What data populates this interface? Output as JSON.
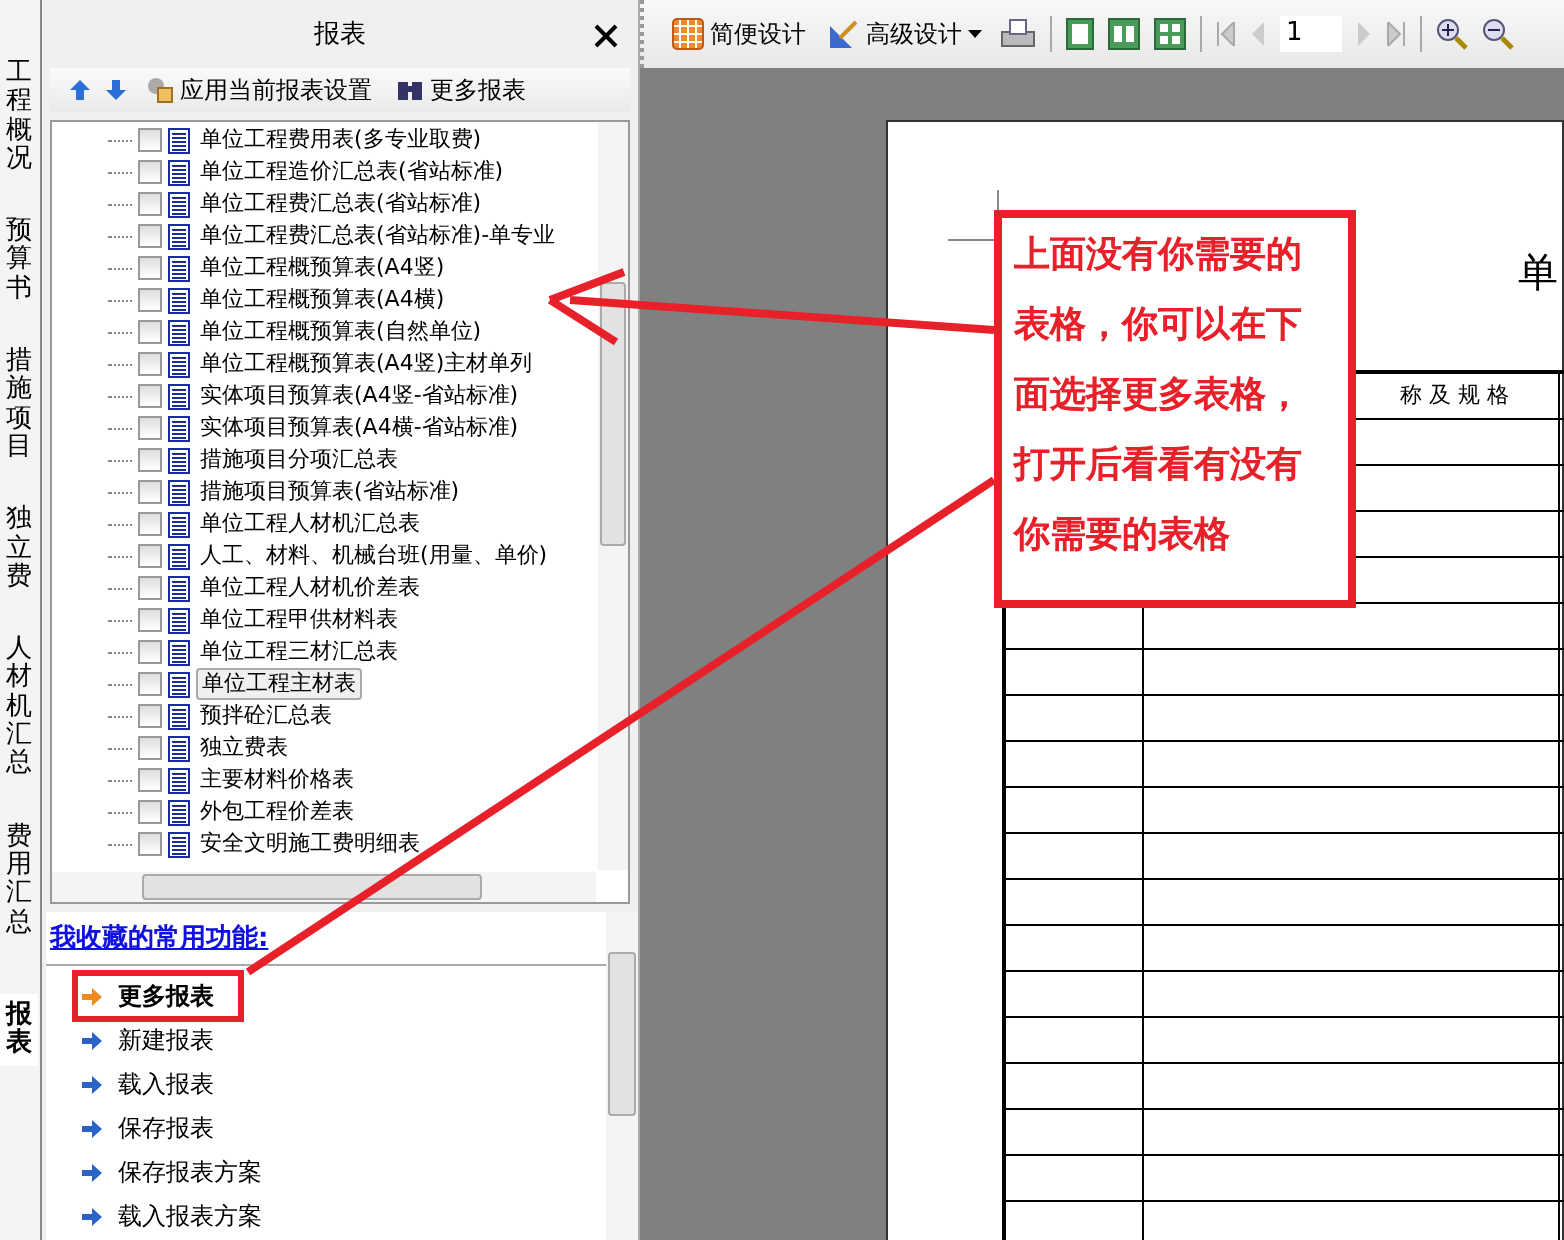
{
  "side_tabs": [
    {
      "label": "工程概况",
      "selected": false
    },
    {
      "label": "预算书",
      "selected": false
    },
    {
      "label": "措施项目",
      "selected": false
    },
    {
      "label": "独立费",
      "selected": false
    },
    {
      "label": "人材机汇总",
      "selected": false
    },
    {
      "label": "费用汇总",
      "selected": false
    },
    {
      "label": "报表",
      "selected": true
    }
  ],
  "panel": {
    "title": "报表"
  },
  "panel_toolbar": {
    "apply_button": "应用当前报表设置",
    "more_button": "更多报表"
  },
  "report_tree": {
    "items": [
      {
        "label": "单位工程费用表(多专业取费)",
        "checked": false,
        "selected": false
      },
      {
        "label": "单位工程造价汇总表(省站标准)",
        "checked": false,
        "selected": false
      },
      {
        "label": "单位工程费汇总表(省站标准)",
        "checked": false,
        "selected": false
      },
      {
        "label": "单位工程费汇总表(省站标准)-单专业",
        "checked": false,
        "selected": false
      },
      {
        "label": "单位工程概预算表(A4竖)",
        "checked": false,
        "selected": false
      },
      {
        "label": "单位工程概预算表(A4横)",
        "checked": false,
        "selected": false
      },
      {
        "label": "单位工程概预算表(自然单位)",
        "checked": false,
        "selected": false
      },
      {
        "label": "单位工程概预算表(A4竖)主材单列",
        "checked": false,
        "selected": false
      },
      {
        "label": "实体项目预算表(A4竖-省站标准)",
        "checked": false,
        "selected": false
      },
      {
        "label": "实体项目预算表(A4横-省站标准)",
        "checked": false,
        "selected": false
      },
      {
        "label": "措施项目分项汇总表",
        "checked": false,
        "selected": false
      },
      {
        "label": "措施项目预算表(省站标准)",
        "checked": false,
        "selected": false
      },
      {
        "label": "单位工程人材机汇总表",
        "checked": false,
        "selected": false
      },
      {
        "label": "人工、材料、机械台班(用量、单价)",
        "checked": false,
        "selected": false
      },
      {
        "label": "单位工程人材机价差表",
        "checked": false,
        "selected": false
      },
      {
        "label": "单位工程甲供材料表",
        "checked": false,
        "selected": false
      },
      {
        "label": "单位工程三材汇总表",
        "checked": false,
        "selected": false
      },
      {
        "label": "单位工程主材表",
        "checked": false,
        "selected": true
      },
      {
        "label": "预拌砼汇总表",
        "checked": false,
        "selected": false
      },
      {
        "label": "独立费表",
        "checked": false,
        "selected": false
      },
      {
        "label": "主要材料价格表",
        "checked": false,
        "selected": false
      },
      {
        "label": "外包工程价差表",
        "checked": false,
        "selected": false
      },
      {
        "label": "安全文明施工费明细表",
        "checked": false,
        "selected": false
      }
    ]
  },
  "favorites": {
    "title": "我收藏的常用功能:",
    "items": [
      {
        "label": "更多报表",
        "selected": true
      },
      {
        "label": "新建报表",
        "selected": false
      },
      {
        "label": "载入报表",
        "selected": false
      },
      {
        "label": "保存报表",
        "selected": false
      },
      {
        "label": "保存报表方案",
        "selected": false
      },
      {
        "label": "载入报表方案",
        "selected": false
      }
    ]
  },
  "viewer_toolbar": {
    "simple_design": "简便设计",
    "advanced_design": "高级设计",
    "page": "1"
  },
  "preview": {
    "title": "单",
    "table_header": "称 及 规 格"
  },
  "annotation": {
    "lines": [
      "上面没有你需要的",
      "表格，你可以在下",
      "面选择更多表格，",
      "打开后看看有没有",
      "你需要的表格"
    ]
  }
}
